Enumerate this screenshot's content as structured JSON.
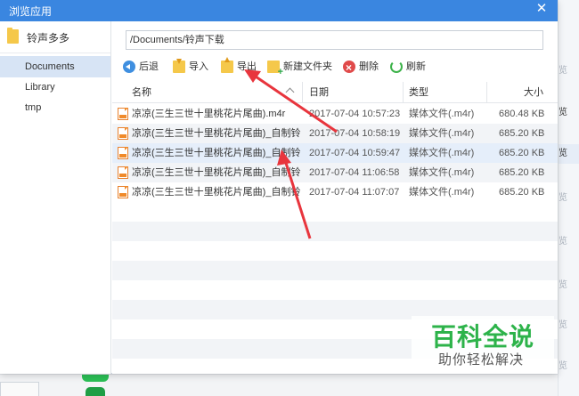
{
  "dialog": {
    "title": "浏览应用",
    "close_glyph": "✕"
  },
  "sidebar": {
    "app_name": "铃声多多",
    "items": [
      {
        "label": "Documents",
        "active": true
      },
      {
        "label": "Library",
        "active": false
      },
      {
        "label": "tmp",
        "active": false
      }
    ]
  },
  "path": {
    "value": "/Documents/铃声下载"
  },
  "toolbar": {
    "back": "后退",
    "import": "导入",
    "export": "导出",
    "new_folder": "新建文件夹",
    "delete": "删除",
    "refresh": "刷新"
  },
  "table": {
    "headers": {
      "name": "名称",
      "date": "日期",
      "type": "类型",
      "size": "大小"
    },
    "rows": [
      {
        "name": "凉凉(三生三世十里桃花片尾曲).m4r",
        "date": "2017-07-04 10:57:23",
        "type": "媒体文件(.m4r)",
        "size": "680.48 KB"
      },
      {
        "name": "凉凉(三生三世十里桃花片尾曲)_自制铃...",
        "date": "2017-07-04 10:58:19",
        "type": "媒体文件(.m4r)",
        "size": "685.20 KB"
      },
      {
        "name": "凉凉(三生三世十里桃花片尾曲)_自制铃...",
        "date": "2017-07-04 10:59:47",
        "type": "媒体文件(.m4r)",
        "size": "685.20 KB"
      },
      {
        "name": "凉凉(三生三世十里桃花片尾曲)_自制铃...",
        "date": "2017-07-04 11:06:58",
        "type": "媒体文件(.m4r)",
        "size": "685.20 KB"
      },
      {
        "name": "凉凉(三生三世十里桃花片尾曲)_自制铃...",
        "date": "2017-07-04 11:07:07",
        "type": "媒体文件(.m4r)",
        "size": "685.20 KB"
      }
    ]
  },
  "background": {
    "right_items": [
      "览",
      "览",
      "览",
      "览",
      "览",
      "览",
      "览",
      "览",
      "览"
    ]
  },
  "watermark": {
    "title": "百科全说",
    "subtitle": "助你轻松解决"
  },
  "colors": {
    "titlebar": "#3a86e0",
    "selection": "#d7e4f5",
    "annotation_arrow": "#e8353d",
    "watermark_green": "#2db34a"
  }
}
